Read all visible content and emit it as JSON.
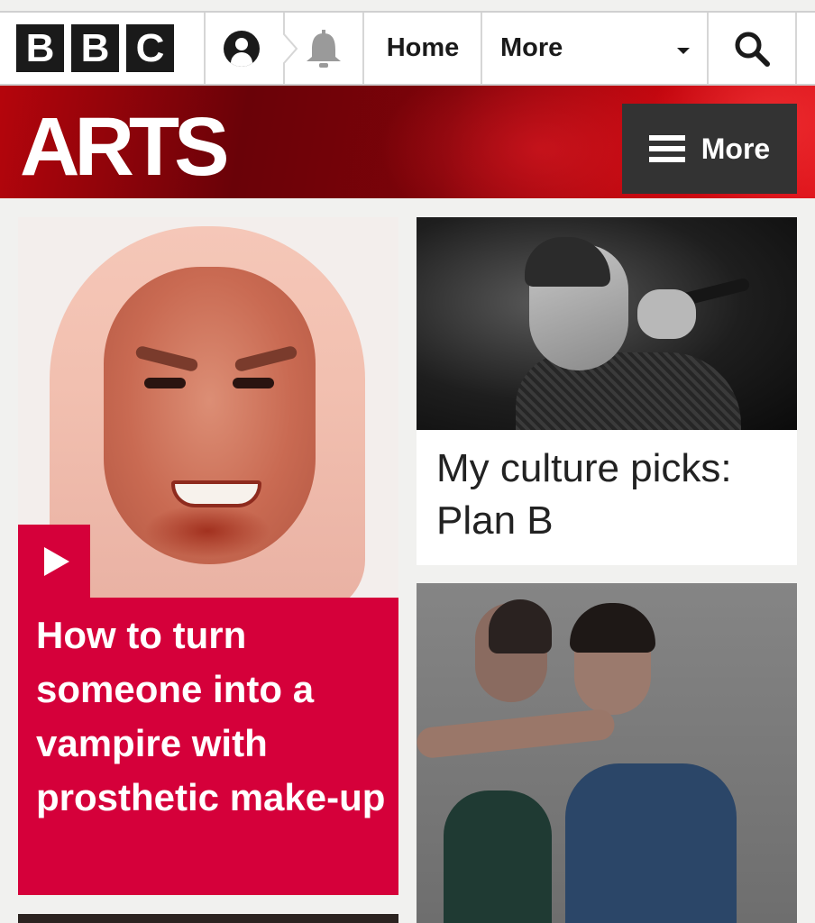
{
  "topbar": {
    "logo_letters": [
      "B",
      "B",
      "C"
    ],
    "account_icon": "account-icon",
    "notifications_icon": "bell-icon",
    "home_label": "Home",
    "more_label": "More",
    "search_icon": "search-icon"
  },
  "arts_header": {
    "title": "ARTS",
    "more_label": "More",
    "menu_icon": "hamburger-icon"
  },
  "cards": [
    {
      "title": "How to turn someone into a vampire with prosthetic make-up",
      "media": "video",
      "play_icon": "play-icon"
    },
    {
      "title": "My culture picks: Plan B"
    },
    {
      "title": ""
    }
  ],
  "colors": {
    "bbc_black": "#1a1a1a",
    "arts_red": "#b5050c",
    "feature_pink": "#d5003a",
    "more_button": "#333333",
    "page_bg": "#f1f1ef"
  }
}
